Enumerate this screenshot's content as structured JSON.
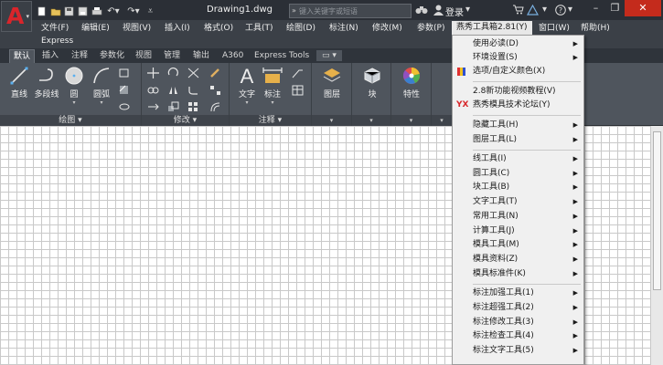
{
  "titlebar": {
    "app_letter": "A",
    "document_title": "Drawing1.dwg",
    "search_placeholder": "键入关键字或短语",
    "login_label": "登录",
    "help_label": "?"
  },
  "menubar": {
    "items": [
      {
        "label": "文件(F)"
      },
      {
        "label": "编辑(E)"
      },
      {
        "label": "视图(V)"
      },
      {
        "label": "插入(I)"
      },
      {
        "label": "格式(O)"
      },
      {
        "label": "工具(T)"
      },
      {
        "label": "绘图(D)"
      },
      {
        "label": "标注(N)"
      },
      {
        "label": "修改(M)"
      },
      {
        "label": "参数(P)"
      },
      {
        "label": "燕秀工具箱2.81(Y)"
      },
      {
        "label": "窗口(W)"
      },
      {
        "label": "帮助(H)"
      }
    ],
    "second_row_label": "Express"
  },
  "ribbon_tabs": [
    {
      "label": "默认"
    },
    {
      "label": "插入"
    },
    {
      "label": "注释"
    },
    {
      "label": "参数化"
    },
    {
      "label": "视图"
    },
    {
      "label": "管理"
    },
    {
      "label": "输出"
    },
    {
      "label": "A360"
    },
    {
      "label": "Express Tools"
    }
  ],
  "ribbon": {
    "draw": {
      "title": "绘图",
      "line": "直线",
      "polyline": "多段线",
      "circle": "圆",
      "arc": "圆弧"
    },
    "modify": {
      "title": "修改"
    },
    "annotation": {
      "title": "注释",
      "text": "文字",
      "dimension": "标注"
    },
    "layers": {
      "label": "图层"
    },
    "block": {
      "label": "块"
    },
    "properties": {
      "label": "特性"
    }
  },
  "dropdown": {
    "items": [
      {
        "label": "使用必读(D)",
        "submenu": true
      },
      {
        "label": "环境设置(S)",
        "submenu": true
      },
      {
        "label": "选项/自定义颜色(X)",
        "submenu": false,
        "icon": "color-palette-icon"
      },
      {
        "label": "2.8新功能视频教程(V)",
        "submenu": false
      },
      {
        "label": "燕秀模具技术论坛(Y)",
        "submenu": false,
        "icon": "yx-logo-icon",
        "icon_text": "YX"
      },
      {
        "label": "隐藏工具(H)",
        "submenu": true
      },
      {
        "label": "图层工具(L)",
        "submenu": true
      },
      {
        "label": "线工具(I)",
        "submenu": true
      },
      {
        "label": "圆工具(C)",
        "submenu": true
      },
      {
        "label": "块工具(B)",
        "submenu": true
      },
      {
        "label": "文字工具(T)",
        "submenu": true
      },
      {
        "label": "常用工具(N)",
        "submenu": true
      },
      {
        "label": "计算工具(J)",
        "submenu": true
      },
      {
        "label": "模具工具(M)",
        "submenu": true
      },
      {
        "label": "模具资料(Z)",
        "submenu": true
      },
      {
        "label": "模具标准件(K)",
        "submenu": true
      },
      {
        "label": "标注加强工具(1)",
        "submenu": true
      },
      {
        "label": "标注超强工具(2)",
        "submenu": true
      },
      {
        "label": "标注修改工具(3)",
        "submenu": true
      },
      {
        "label": "标注检查工具(4)",
        "submenu": true
      },
      {
        "label": "标注文字工具(5)",
        "submenu": true
      }
    ]
  },
  "colors": {
    "app_red": "#d9252b",
    "titlebar_bg": "#2b2f36",
    "ribbon_bg": "#4f555d",
    "menu_bg": "#f0f0f0",
    "grid_line": "#c9c9c9"
  }
}
